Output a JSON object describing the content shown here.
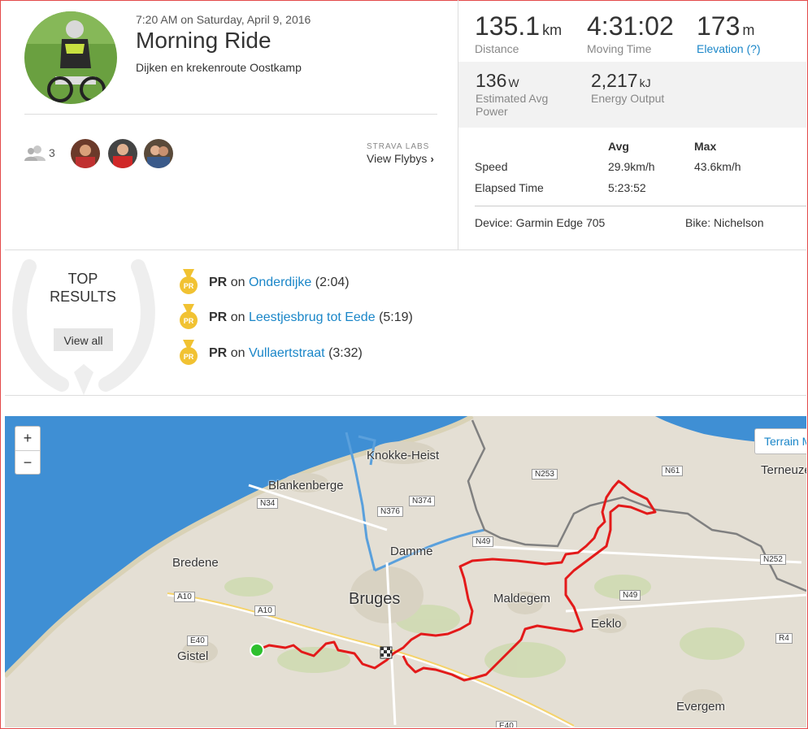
{
  "activity": {
    "timestamp": "7:20 AM on Saturday, April 9, 2016",
    "title": "Morning Ride",
    "description": "Dijken en krekenroute Oostkamp",
    "athlete_count": "3",
    "labs_label": "STRAVA LABS",
    "flybys_label": "View Flybys"
  },
  "stats": {
    "distance": {
      "value": "135.1",
      "unit": "km",
      "label": "Distance"
    },
    "moving_time": {
      "value": "4:31:02",
      "label": "Moving Time"
    },
    "elevation": {
      "value": "173",
      "unit": "m",
      "label": "Elevation (?)"
    },
    "power": {
      "value": "136",
      "unit": "W",
      "label": "Estimated Avg Power"
    },
    "energy": {
      "value": "2,217",
      "unit": "kJ",
      "label": "Energy Output"
    }
  },
  "table": {
    "headers": [
      "Avg",
      "Max"
    ],
    "rows": [
      {
        "label": "Speed",
        "avg": "29.9km/h",
        "max": "43.6km/h"
      },
      {
        "label": "Elapsed Time",
        "avg": "5:23:52",
        "max": ""
      }
    ]
  },
  "gear": {
    "device": "Device: Garmin Edge 705",
    "bike": "Bike: Nichelson"
  },
  "top_results": {
    "title_line1": "TOP",
    "title_line2": "RESULTS",
    "view_all": "View all",
    "items": [
      {
        "badge": "PR",
        "on": "on",
        "segment": "Onderdijke",
        "time": "(2:04)"
      },
      {
        "badge": "PR",
        "on": "on",
        "segment": "Leestjesbrug tot Eede",
        "time": "(5:19)"
      },
      {
        "badge": "PR",
        "on": "on",
        "segment": "Vullaertstraat",
        "time": "(3:32)"
      }
    ]
  },
  "map": {
    "zoom_in": "+",
    "zoom_out": "−",
    "terrain_label": "Terrain M",
    "cities": [
      "Knokke-Heist",
      "Blankenberge",
      "Damme",
      "Bredene",
      "Bruges",
      "Maldegem",
      "Eeklo",
      "Gistel",
      "Evergem",
      "Terneuzen"
    ],
    "roads": [
      "N253",
      "N61",
      "N34",
      "N376",
      "N374",
      "N49",
      "N252",
      "A10",
      "A10",
      "N49",
      "E40",
      "R4",
      "E40"
    ]
  },
  "colors": {
    "accent": "#1a86c8",
    "route": "#e31a1a",
    "sea": "#3f8fd4",
    "land": "#e4dfd4",
    "frame": "#e34a4a"
  }
}
